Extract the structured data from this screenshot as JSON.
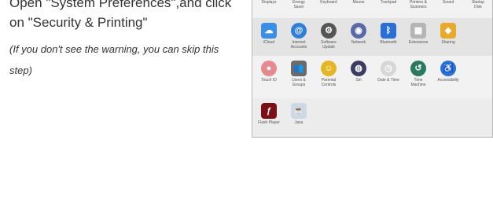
{
  "instructions": {
    "line1": "Open \"System Preferences\",and click",
    "line2": "on \"Security & Printing\"",
    "note1": "(If you don't see the warning, you can skip this",
    "note2": "step)"
  },
  "system_preferences": {
    "row0": [
      "Displays",
      "Energy\nSaver",
      "Keyboard",
      "Mouse",
      "Trackpad",
      "Printers &\nScanners",
      "Sound",
      "Startup\nDisk"
    ],
    "row1": [
      "iCloud",
      "Internet\nAccounts",
      "Software\nUpdate",
      "Network",
      "Bluetooth",
      "Extensions",
      "Sharing"
    ],
    "row2": [
      "Touch ID",
      "Users &\nGroups",
      "Parental\nControls",
      "Siri",
      "Date & Time",
      "Time\nMachine",
      "Accessibility"
    ],
    "row3": [
      "Flash Player",
      "Java"
    ]
  },
  "icons": {
    "row1": [
      "cloud-icon",
      "at-sign-icon",
      "gear-icon",
      "globe-icon",
      "bluetooth-icon",
      "puzzle-icon",
      "sharing-icon"
    ],
    "row2": [
      "fingerprint-icon",
      "users-icon",
      "parental-icon",
      "siri-icon",
      "clock-icon",
      "time-machine-icon",
      "accessibility-icon"
    ],
    "row3": [
      "flash-icon",
      "java-icon"
    ]
  },
  "colors": {
    "window_bg": "#ececec",
    "text": "#333333"
  }
}
